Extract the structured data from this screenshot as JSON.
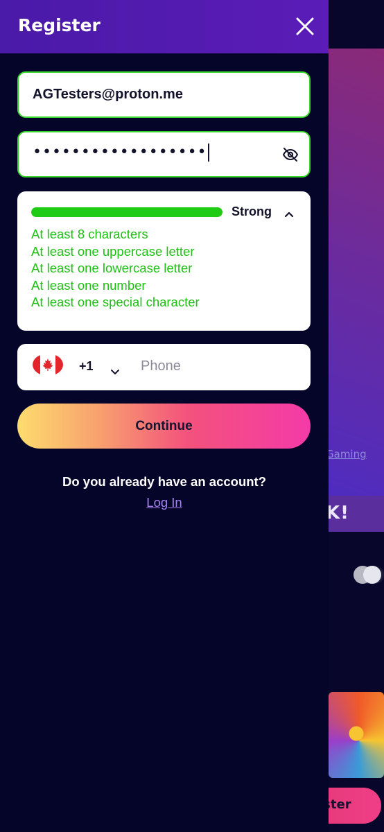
{
  "drawer": {
    "title": "Register",
    "close_icon": "close-icon"
  },
  "form": {
    "email_value": "AGTesters@proton.me",
    "password_mask": "••••••••••••••••••",
    "password_toggle_icon": "eye-off-icon",
    "strength": {
      "label": "Strong",
      "level": 1.0,
      "color": "#1fcb14",
      "toggle_icon": "chevron-up-icon",
      "requirements": [
        "At least 8 characters",
        "At least one uppercase letter",
        "At least one lowercase letter",
        "At least one number",
        "At least one special character"
      ]
    },
    "phone": {
      "flag_icon": "canada-flag-icon",
      "country_code": "+1",
      "code_chevron_icon": "chevron-down-icon",
      "placeholder": "Phone"
    },
    "continue_label": "Continue"
  },
  "footer": {
    "question": "Do you already have an account?",
    "login_label": "Log In"
  },
  "background": {
    "link_fragment": "Gaming",
    "promo_fragment": "K!",
    "button_fragment": "ister"
  },
  "colors": {
    "header": "#4a1aa8",
    "panel": "#05052a",
    "valid_green": "#37d62a",
    "link_purple": "#a783f0"
  }
}
